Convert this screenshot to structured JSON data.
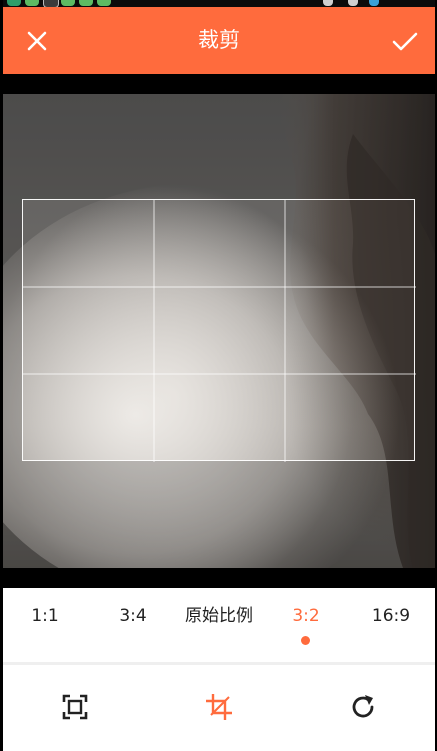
{
  "topbar": {
    "title": "裁剪",
    "accent_color": "#ff6b3d",
    "close_icon": "close-icon",
    "confirm_icon": "check-icon"
  },
  "ratios": [
    {
      "label": "1:1",
      "active": false
    },
    {
      "label": "3:4",
      "active": false
    },
    {
      "label": "原始比例",
      "active": false
    },
    {
      "label": "3:2",
      "active": true
    },
    {
      "label": "16:9",
      "active": false
    }
  ],
  "tools": [
    {
      "name": "fit-frame-icon",
      "active": false
    },
    {
      "name": "crop-icon",
      "active": true
    },
    {
      "name": "rotate-icon",
      "active": false
    }
  ],
  "colors": {
    "accent": "#ff6b3d",
    "text": "#222222"
  }
}
